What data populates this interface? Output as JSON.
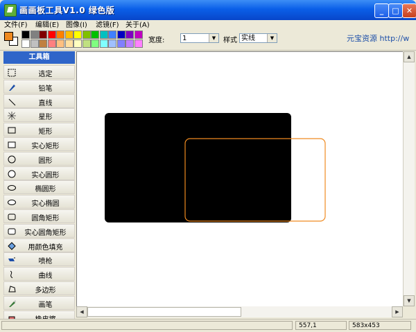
{
  "window": {
    "title": "画画板工具V1.0 绿色版"
  },
  "menu": [
    "文件(F)",
    "编辑(E)",
    "图像(I)",
    "滤镜(F)",
    "关于(A)"
  ],
  "toolbar": {
    "width_label": "宽度:",
    "width_value": "1",
    "style_label": "样式",
    "style_value": "实线",
    "link": "元宝资源 http://w"
  },
  "colors": {
    "foreground": "#ef8a20",
    "background": "#ffffff",
    "palette_top": [
      "#000000",
      "#808080",
      "#800000",
      "#ff0000",
      "#ff8000",
      "#ffc000",
      "#ffff00",
      "#80c000",
      "#00c000",
      "#00c0c0",
      "#4080ff",
      "#0000c0",
      "#8000c0",
      "#c000c0"
    ],
    "palette_bottom": [
      "#ffffff",
      "#c0c0c0",
      "#c08040",
      "#ff8080",
      "#ffc080",
      "#ffe0a0",
      "#ffffc0",
      "#c0e080",
      "#80ff80",
      "#80ffff",
      "#a0c0ff",
      "#8080ff",
      "#c080ff",
      "#ff80ff"
    ]
  },
  "toolbox": {
    "title": "工具箱",
    "tools": [
      {
        "label": "选定",
        "icon": "select-icon"
      },
      {
        "label": "铅笔",
        "icon": "pencil-icon"
      },
      {
        "label": "直线",
        "icon": "line-icon"
      },
      {
        "label": "星形",
        "icon": "star-icon"
      },
      {
        "label": "矩形",
        "icon": "rectangle-icon"
      },
      {
        "label": "实心矩形",
        "icon": "filled-rectangle-icon"
      },
      {
        "label": "圆形",
        "icon": "circle-icon"
      },
      {
        "label": "实心圆形",
        "icon": "filled-circle-icon"
      },
      {
        "label": "椭圆形",
        "icon": "ellipse-icon"
      },
      {
        "label": "实心椭圆",
        "icon": "filled-ellipse-icon"
      },
      {
        "label": "圆角矩形",
        "icon": "rounded-rectangle-icon"
      },
      {
        "label": "实心圆角矩形",
        "icon": "filled-rounded-rectangle-icon"
      },
      {
        "label": "用颜色填充",
        "icon": "fill-icon"
      },
      {
        "label": "喷枪",
        "icon": "airbrush-icon"
      },
      {
        "label": "曲线",
        "icon": "curve-icon"
      },
      {
        "label": "多边形",
        "icon": "polygon-icon"
      },
      {
        "label": "画笔",
        "icon": "brush-icon"
      },
      {
        "label": "橡皮擦",
        "icon": "eraser-icon"
      }
    ]
  },
  "canvas": {
    "shapes": [
      {
        "type": "filled-rounded-rectangle",
        "fill": "#000000"
      },
      {
        "type": "rounded-rectangle",
        "stroke": "#ef8a20"
      }
    ]
  },
  "status": {
    "cell1": "",
    "coords": "557,1",
    "size": "583x453"
  }
}
